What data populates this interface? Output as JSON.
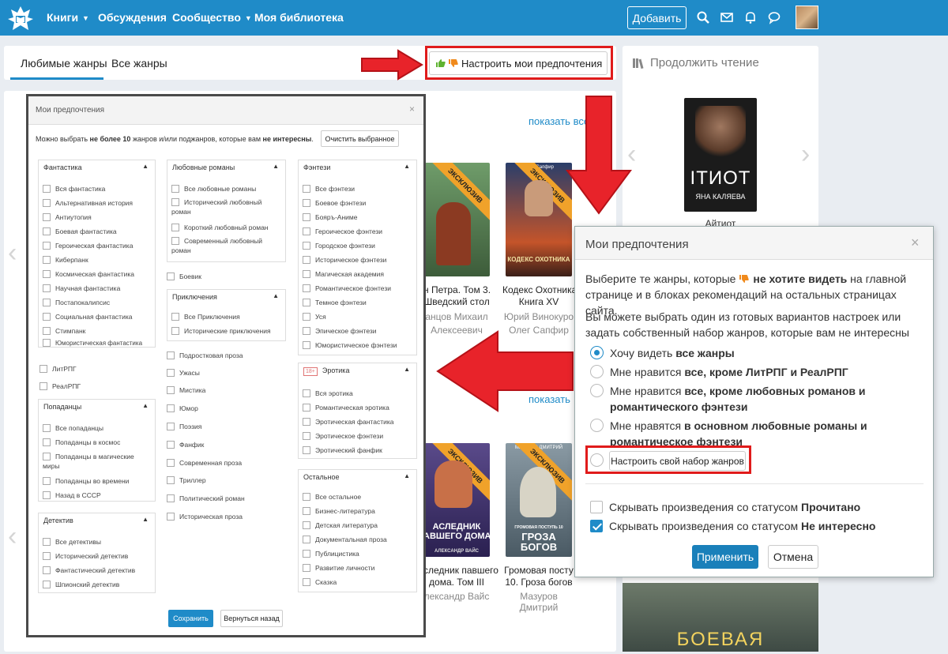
{
  "nav": {
    "items": [
      "Книги",
      "Обсуждения",
      "Сообщество",
      "Моя библиотека"
    ],
    "add_label": "Добавить"
  },
  "tabs": {
    "favorite": "Любимые жанры",
    "all": "Все жанры",
    "pref_button": "Настроить мои предпочтения"
  },
  "sidebar": {
    "title": "Продолжить чтение",
    "book_cover_title": "ITИОТ",
    "book_cover_author": "ЯНА КАЛЯЕВА",
    "book_name": "Айтиот",
    "bottom_cover_title": "БОЕВАЯ"
  },
  "content": {
    "show_all_1": "показать все",
    "show_all_2": "показать",
    "books_row1": [
      {
        "title": "н Петра. Том 3.\nШведский стол",
        "author": "анцов Михаил\nАлексеевич",
        "ribbon": "ЭКСКЛЮЗИВ"
      },
      {
        "title": "Кодекс Охотника.\nКнига XV",
        "author": "Юрий Винокуро\nОлег Сапфир",
        "ribbon": "ЭКСКЛЮЗИВ",
        "cover_text": "КОДЕКС ОХОТНИКА",
        "cover_author": "Олег Сапфир"
      }
    ],
    "books_row2": [
      {
        "title": "следник павшего\nдома. Том III",
        "author": "лександр Вайс",
        "ribbon": "ЭКСКЛЮЗИВ",
        "cover_text": "АСЛЕДНИК\nАВШЕГО ДОМА",
        "cover_author": "АЛЕКСАНДР ВАЙС"
      },
      {
        "title": "Громовая посту\n10. Гроза богов",
        "author": "Мазуров Дмитрий",
        "ribbon": "ЭКСКЛЮЗИВ",
        "cover_text": "ГРОЗА\nБОГОВ",
        "cover_sub": "ГРОМОВАЯ ПОСТУПЬ 10",
        "cover_author": "МАЗУРОВ ДМИТРИЙ"
      }
    ]
  },
  "big_modal": {
    "title": "Мои предпочтения",
    "close": "×",
    "desc_pre": "Можно выбрать ",
    "desc_bold1": "не более 10",
    "desc_mid": " жанров и/или поджанров, которые вам ",
    "desc_bold2": "не интересны",
    "desc_end": ".",
    "clear_label": "Очистить выбранное",
    "groups": {
      "fantastika": {
        "title": "Фантастика",
        "items": [
          "Вся фантастика",
          "Альтернативная история",
          "Антиутопия",
          "Боевая фантастика",
          "Героическая фантастика",
          "Киберпанк",
          "Космическая фантастика",
          "Научная фантастика",
          "Постапокалипсис",
          "Социальная фантастика",
          "Стимпанк",
          "Юмористическая фантастика"
        ]
      },
      "lyubovnye": {
        "title": "Любовные романы",
        "items": [
          "Все любовные романы",
          "Исторический любовный роман",
          "Короткий любовный роман",
          "Современный любовный роман"
        ]
      },
      "fentezi": {
        "title": "Фэнтези",
        "items": [
          "Все фэнтези",
          "Боевое фэнтези",
          "Бояръ-Аниме",
          "Героическое фэнтези",
          "Городское фэнтези",
          "Историческое фэнтези",
          "Магическая академия",
          "Романтическое фэнтези",
          "Темное фэнтези",
          "Уся",
          "Эпическое фэнтези",
          "Юмористическое фэнтези"
        ]
      },
      "prikl": {
        "title": "Приключения",
        "items": [
          "Все Приключения",
          "Исторические приключения"
        ]
      },
      "popadantsy": {
        "title": "Попаданцы",
        "items": [
          "Все попаданцы",
          "Попаданцы в космос",
          "Попаданцы в магические миры",
          "Попаданцы во времени",
          "Назад в СССР"
        ]
      },
      "erotika": {
        "title": "Эротика",
        "badge": "18+",
        "items": [
          "Вся эротика",
          "Романтическая эротика",
          "Эротическая фантастика",
          "Эротическое фэнтези",
          "Эротический фанфик"
        ]
      },
      "detektiv": {
        "title": "Детектив",
        "items": [
          "Все детективы",
          "Исторический детектив",
          "Фантастический детектив",
          "Шпионский детектив"
        ]
      },
      "ostalnoe": {
        "title": "Остальное",
        "items": [
          "Все остальное",
          "Бизнес-литература",
          "Детская литература",
          "Документальная проза",
          "Публицистика",
          "Развитие личности",
          "Сказка"
        ]
      }
    },
    "free_left": [
      "ЛитРПГ",
      "РеалРПГ"
    ],
    "free_mid": [
      "Боевик",
      "Подростковая проза",
      "Ужасы",
      "Мистика",
      "Юмор",
      "Поэзия",
      "Фанфик",
      "Современная проза",
      "Триллер",
      "Политический роман",
      "Историческая проза"
    ],
    "save_label": "Сохранить",
    "back_label": "Вернуться назад"
  },
  "small_modal": {
    "title": "Мои предпочтения",
    "close": "×",
    "p1_a": "Выберите те жанры, которые ",
    "p1_bold": "не хотите видеть",
    "p1_b": " на главной странице и в блоках рекомендаций на остальных страницах сайта.",
    "p2": "Вы можете выбрать один из готовых вариантов настроек или задать собственный набор жанров, которые вам не интересны",
    "options": [
      {
        "pre": "Хочу видеть ",
        "bold": "все жанры",
        "selected": true
      },
      {
        "pre": "Мне нравится ",
        "bold": "все, кроме ЛитРПГ и РеалРПГ",
        "selected": false
      },
      {
        "pre": "Мне нравится ",
        "bold": "все, кроме любовных романов и романтического фэнтези",
        "selected": false
      },
      {
        "pre": "Мне нравятся ",
        "bold": "в основном любовные романы и романтическое фэнтези",
        "selected": false
      }
    ],
    "custom_label": "Настроить свой набор жанров",
    "hide_read_pre": "Скрывать произведения со статусом ",
    "hide_read_bold": "Прочитано",
    "hide_read_checked": false,
    "hide_ni_pre": "Скрывать произведения со статусом ",
    "hide_ni_bold": "Не интересно",
    "hide_ni_checked": true,
    "apply_label": "Применить",
    "cancel_label": "Отмена"
  },
  "colors": {
    "brand": "#1f8bc8",
    "annotation_red": "#e01b1b",
    "ribbon": "#f0a22a"
  }
}
